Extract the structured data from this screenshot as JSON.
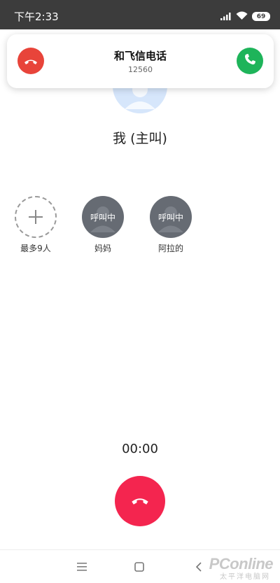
{
  "status_bar": {
    "time": "下午2:33",
    "battery": "69",
    "icons": [
      "signal-icon",
      "wifi-icon",
      "battery-icon"
    ]
  },
  "incoming_call": {
    "title": "和飞信电话",
    "number": "12560",
    "decline_icon": "hangup-icon",
    "answer_icon": "phone-icon",
    "decline_color": "#e8443a",
    "answer_color": "#1eb45a"
  },
  "host": {
    "label": "我 (主叫)",
    "avatar_color": "#d6e6fb"
  },
  "participants": [
    {
      "name": "最多9人",
      "type": "add",
      "icon": "plus-icon"
    },
    {
      "name": "妈妈",
      "status": "呼叫中",
      "type": "calling"
    },
    {
      "name": "阿拉的",
      "status": "呼叫中",
      "type": "calling"
    }
  ],
  "call": {
    "timer": "00:00",
    "hangup_color": "#f4254f"
  },
  "nav_bar": {
    "items": [
      "menu-icon",
      "home-icon",
      "back-icon"
    ]
  },
  "watermark": {
    "text": "PConline",
    "sub": "太平洋电脑网"
  }
}
